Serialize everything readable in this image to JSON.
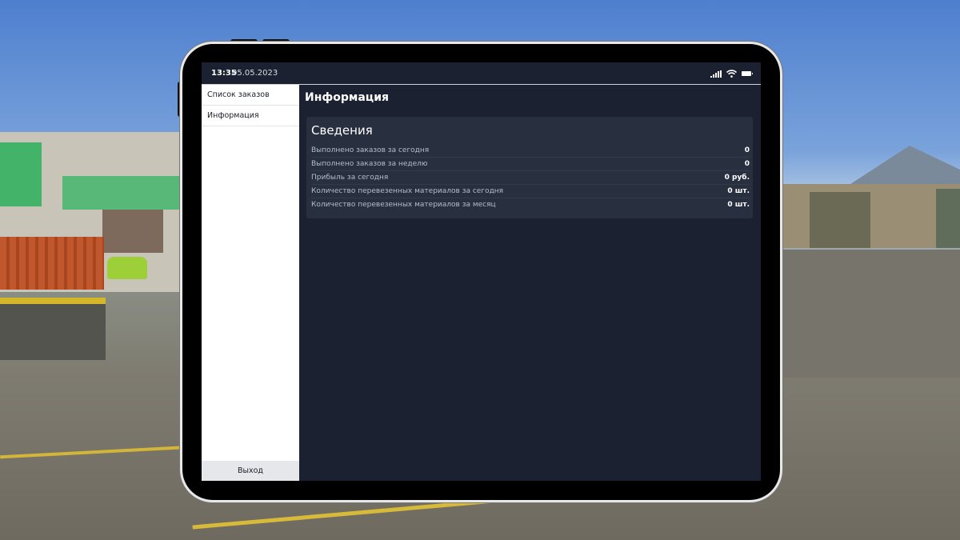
{
  "status_bar": {
    "time": "13:35",
    "date": "05.05.2023",
    "icons": [
      "signal-icon",
      "wifi-icon",
      "battery-icon"
    ]
  },
  "sidebar": {
    "items": [
      {
        "label": "Список заказов"
      },
      {
        "label": "Информация"
      }
    ],
    "exit_label": "Выход"
  },
  "main": {
    "title": "Информация",
    "card": {
      "title": "Сведения",
      "rows": [
        {
          "label": "Выполнено заказов за сегодня",
          "value": "0"
        },
        {
          "label": "Выполнено заказов за неделю",
          "value": "0"
        },
        {
          "label": "Прибыль за сегодня",
          "value": "0 руб."
        },
        {
          "label": "Количество перевезенных материалов за сегодня",
          "value": "0 шт."
        },
        {
          "label": "Количество перевезенных материалов за месяц",
          "value": "0 шт."
        }
      ]
    }
  },
  "colors": {
    "screen_bg": "#1b2130",
    "card_bg": "#283040",
    "sidebar_bg": "#ffffff",
    "accent_text": "#ffffff"
  }
}
